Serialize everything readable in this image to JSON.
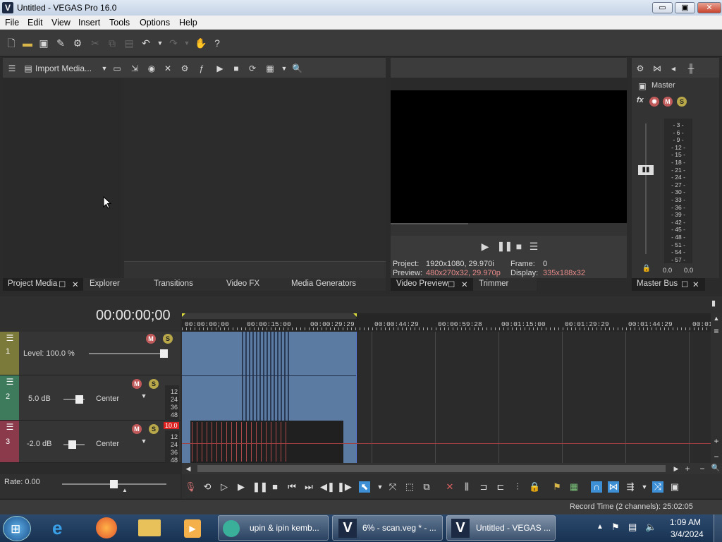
{
  "window": {
    "title": "Untitled - VEGAS Pro 16.0",
    "app_icon": "V",
    "minimize": "▭",
    "maximize": "▣",
    "close": "✕"
  },
  "menu": [
    "File",
    "Edit",
    "View",
    "Insert",
    "Tools",
    "Options",
    "Help"
  ],
  "media_toolbar": {
    "import_label": "Import Media..."
  },
  "project_media_tabs": [
    "Project Media",
    "Explorer",
    "Transitions",
    "Video FX",
    "Media Generators"
  ],
  "preview": {
    "project_label": "Project:",
    "project_value": "1920x1080, 29.970i",
    "preview_label": "Preview:",
    "preview_value": "480x270x32, 29.970p",
    "frame_label": "Frame:",
    "frame_value": "0",
    "display_label": "Display:",
    "display_value": "335x188x32",
    "tabs": [
      "Video Preview",
      "Trimmer"
    ]
  },
  "master": {
    "label": "Master",
    "fx": "fx",
    "scale": [
      "3",
      "6",
      "9",
      "12",
      "15",
      "18",
      "21",
      "24",
      "27",
      "30",
      "33",
      "36",
      "39",
      "42",
      "45",
      "48",
      "51",
      "54",
      "57"
    ],
    "left_value": "0.0",
    "right_value": "0.0",
    "tab": "Master Bus"
  },
  "timeline": {
    "timecode": "00:00:00;00",
    "ruler": [
      "00:00:00;00",
      "00:00:15:00",
      "00:00:29:29",
      "00:00:44:29",
      "00:00:59:28",
      "00:01:15:00",
      "00:01:29:29",
      "00:01:44:29",
      "00:01"
    ],
    "tracks": [
      {
        "number": "1",
        "level": "Level: 100.0 %",
        "color": "#7c7a3a"
      },
      {
        "number": "2",
        "volume": "5.0 dB",
        "pan": "Center",
        "color": "#3e7a5c",
        "scale": [
          "12",
          "24",
          "36",
          "48"
        ]
      },
      {
        "number": "3",
        "volume": "-2.0 dB",
        "pan": "Center",
        "color": "#8a3a4a",
        "scale": [
          "12",
          "24",
          "36",
          "48"
        ],
        "peak": "10.0"
      }
    ],
    "rate": "Rate: 0.00"
  },
  "status": {
    "record_time": "Record Time (2 channels): 25:02:05"
  },
  "taskbar": {
    "tasks": [
      "upin & ipin kemb...",
      "6% - scan.veg * - ...",
      "Untitled - VEGAS ..."
    ],
    "time": "1:09 AM",
    "date": "3/4/2024"
  },
  "colors": {
    "accent": "#3d8fd6",
    "clip_video": "#5b7ba3",
    "clip_audio": "#202020"
  }
}
